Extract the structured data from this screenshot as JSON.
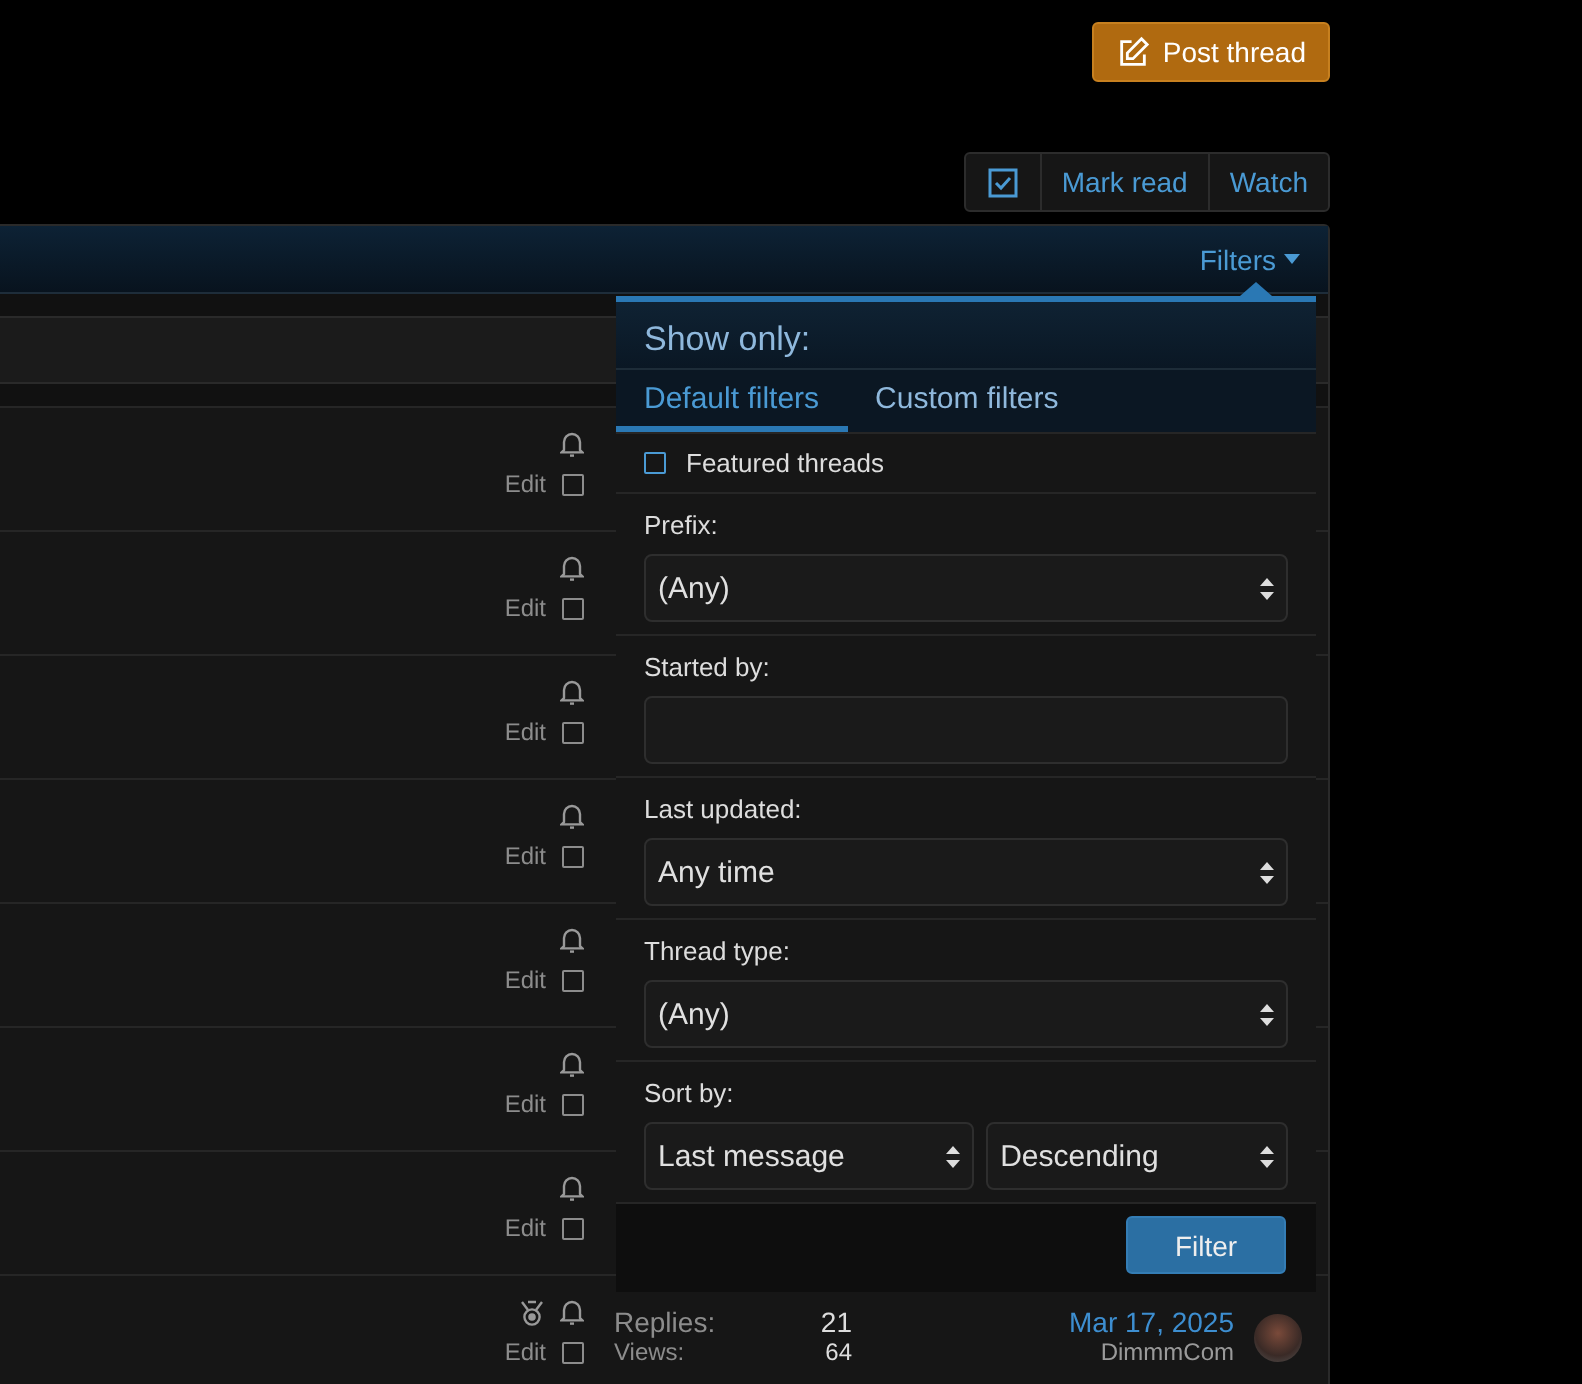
{
  "post_thread": "Post thread",
  "toolbar": [
    {
      "kind": "select-icon"
    },
    {
      "kind": "text",
      "label": "Mark read"
    },
    {
      "kind": "text",
      "label": "Watch"
    }
  ],
  "filters_link": "Filters",
  "threads": [
    {
      "featured": false,
      "edit": "Edit",
      "checked": false
    },
    {
      "featured": false,
      "edit": "Edit",
      "checked": false
    },
    {
      "featured": false,
      "edit": "Edit",
      "checked": false
    },
    {
      "featured": false,
      "edit": "Edit",
      "checked": false
    },
    {
      "featured": false,
      "edit": "Edit",
      "checked": false
    },
    {
      "featured": false,
      "edit": "Edit",
      "checked": false
    },
    {
      "featured": false,
      "edit": "Edit",
      "checked": false
    },
    {
      "featured": true,
      "edit": "Edit",
      "checked": false,
      "stats": {
        "replies_label": "Replies:",
        "replies": "21",
        "views_label": "Views:",
        "views": "64",
        "last_date": "Mar 17, 2025",
        "last_user": "DimmmCom"
      }
    }
  ],
  "filter_menu": {
    "title": "Show only:",
    "tabs": [
      {
        "label": "Default filters",
        "selected": true
      },
      {
        "label": "Custom filters",
        "selected": false
      }
    ],
    "featured": {
      "label": "Featured threads",
      "checked": false
    },
    "fields": [
      {
        "kind": "select",
        "label": "Prefix:",
        "value": "(Any)"
      },
      {
        "kind": "text",
        "label": "Started by:"
      },
      {
        "kind": "select",
        "label": "Last updated:",
        "value": "Any time"
      },
      {
        "kind": "select",
        "label": "Thread type:",
        "value": "(Any)"
      },
      {
        "kind": "select-pair",
        "label": "Sort by:",
        "values": [
          "Last message",
          "Descending"
        ]
      }
    ],
    "submit": "Filter"
  }
}
